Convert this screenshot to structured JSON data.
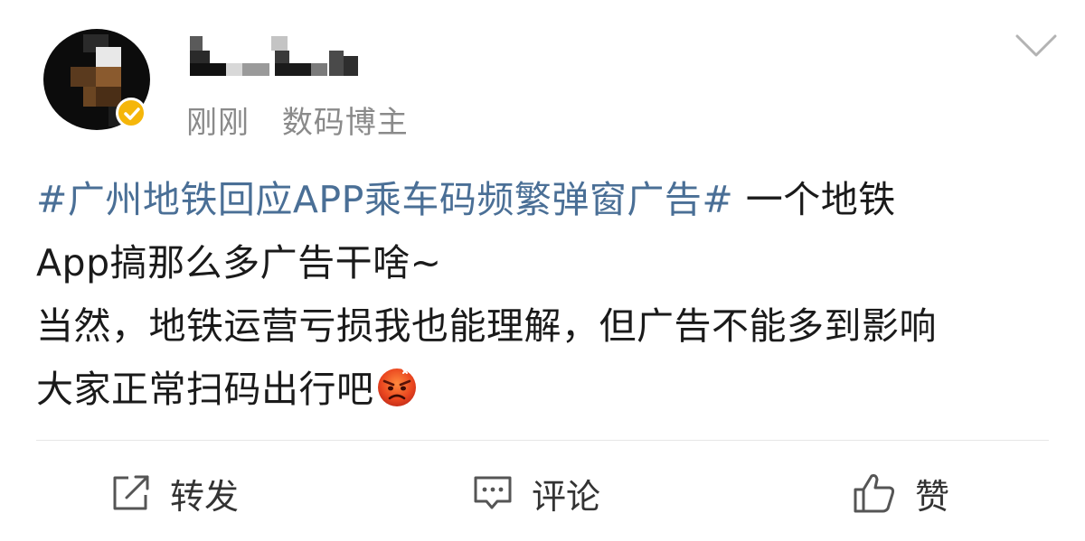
{
  "header": {
    "time": "刚刚",
    "source": "数码博主"
  },
  "post": {
    "hashtag": "#广州地铁回应APP乘车码频繁弹窗广告#",
    "line1_text": " 一个地铁",
    "line2": "App搞那么多广告干啥~",
    "line3": "当然，地铁运营亏损我也能理解，但广告不能多到影响",
    "line4": "大家正常扫码出行吧",
    "emoji_name": "angry-face-icon"
  },
  "actions": {
    "repost_label": "转发",
    "comment_label": "评论",
    "like_label": "赞"
  },
  "colors": {
    "hashtag": "#4a6f96",
    "meta": "#8a8a8a",
    "verified_badge": "#f5b60a",
    "text": "#1a1a1a"
  }
}
